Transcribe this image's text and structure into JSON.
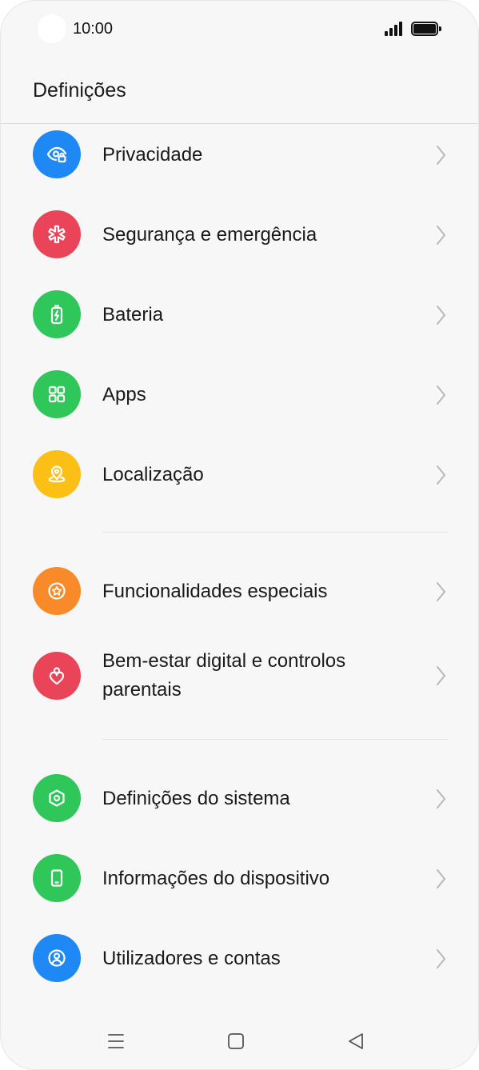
{
  "status_bar": {
    "time": "10:00",
    "signal_icon": "signal-icon",
    "battery_icon": "battery-icon"
  },
  "header": {
    "title": "Definições"
  },
  "items": [
    {
      "label": "Privacidade",
      "icon": "privacy-eye-icon",
      "color": "#1e88f5"
    },
    {
      "label": "Segurança e emergência",
      "icon": "emergency-asterisk-icon",
      "color": "#ea4458"
    },
    {
      "label": "Bateria",
      "icon": "battery-charging-icon",
      "color": "#2fc65a"
    },
    {
      "label": "Apps",
      "icon": "apps-grid-icon",
      "color": "#2fc65a"
    },
    {
      "label": "Localização",
      "icon": "location-pin-icon",
      "color": "#fbbf15"
    },
    {
      "label": "Funcionalidades especiais",
      "icon": "special-features-star-icon",
      "color": "#f98a2a"
    },
    {
      "label": "Bem-estar digital e controlos parentais",
      "icon": "digital-wellbeing-heart-icon",
      "color": "#ea4458"
    },
    {
      "label": "Definições do sistema",
      "icon": "system-settings-hexagon-icon",
      "color": "#2fc65a"
    },
    {
      "label": "Informações do dispositivo",
      "icon": "device-info-phone-icon",
      "color": "#2fc65a"
    },
    {
      "label": "Utilizadores e contas",
      "icon": "users-accounts-icon",
      "color": "#1e88f5"
    }
  ],
  "nav_bar": {
    "menu_icon": "menu-icon",
    "home_icon": "home-icon",
    "back_icon": "back-icon"
  }
}
